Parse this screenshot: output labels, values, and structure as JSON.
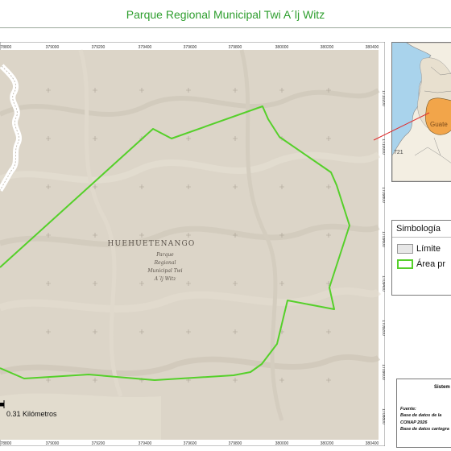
{
  "title": "Parque Regional Municipal Twi A´lj Witz",
  "map": {
    "department_label": "HUEHUETENANGO",
    "park_label_lines": [
      "Parque",
      "Regional",
      "Municipal Twi",
      "A´lj Witz"
    ],
    "x_ticks": [
      "378800",
      "379000",
      "379200",
      "379400",
      "379600",
      "379800",
      "380000",
      "380200",
      "380400"
    ],
    "y_ticks": [
      "1710200",
      "1710000",
      "1709800",
      "1709600",
      "1709400",
      "1709200",
      "1709000",
      "1708800"
    ],
    "scale_label": "0.31 Kilómetros",
    "colors": {
      "terrain": "#dcd5c8",
      "boundary": "#55d02a",
      "road": "#ffffff"
    }
  },
  "inset": {
    "highlight_label": "Guate",
    "number_label": "721",
    "colors": {
      "highlight": "#f2a54a",
      "sea": "#a9d3ec",
      "pointer": "#e03030"
    }
  },
  "legend": {
    "title": "Simbología",
    "items": [
      {
        "label": "Límite",
        "symbol": "grey-box"
      },
      {
        "label": "Área pr",
        "symbol": "green-outline-box"
      }
    ]
  },
  "info": {
    "heading": "Sistem",
    "source_label": "Fuente:",
    "lines": [
      "Base de datos de la",
      "CONAP 2026",
      "Base de datos cartogra"
    ]
  }
}
